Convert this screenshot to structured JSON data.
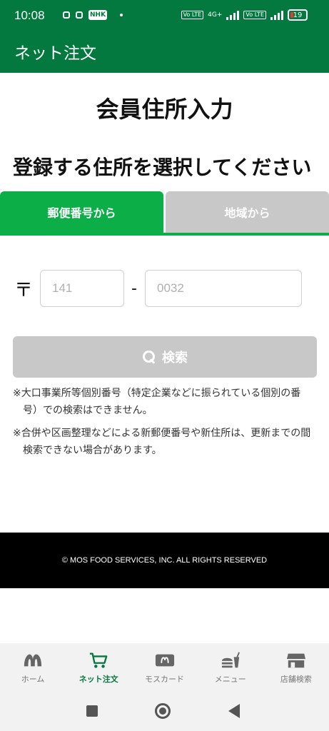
{
  "status_bar": {
    "time": "10:08",
    "nhk_label": "NHK",
    "network": "4G+",
    "volte_1": "Vo LTE",
    "volte_2": "Vo LTE",
    "battery": "19"
  },
  "app_bar": {
    "title": "ネット注文"
  },
  "page": {
    "title": "会員住所入力",
    "subtitle": "登録する住所を選択してください"
  },
  "tabs": [
    {
      "label": "郵便番号から",
      "active": true
    },
    {
      "label": "地域から",
      "active": false
    }
  ],
  "postal": {
    "symbol": "〒",
    "first_placeholder": "141",
    "separator": "-",
    "second_placeholder": "0032"
  },
  "search_button": {
    "label": "検索",
    "icon": "search-icon"
  },
  "notes": [
    "※大口事業所等個別番号（特定企業などに振られている個別の番号）での検索はできません。",
    "※合併や区画整理などによる新郵便番号や新住所は、更新までの間検索できない場合があります。"
  ],
  "footer": {
    "copyright": "© MOS FOOD SERVICES, INC. ALL RIGHTS RESERVED"
  },
  "bottom_nav": [
    {
      "label": "ホーム",
      "icon": "mos-logo-icon",
      "active": false
    },
    {
      "label": "ネット注文",
      "icon": "cart-icon",
      "active": true
    },
    {
      "label": "モスカード",
      "icon": "card-icon",
      "active": false
    },
    {
      "label": "メニュー",
      "icon": "burger-drink-icon",
      "active": false
    },
    {
      "label": "店舗検索",
      "icon": "store-icon",
      "active": false
    }
  ],
  "colors": {
    "brand_green": "#04793f",
    "tab_active": "#0cae48",
    "tab_inactive": "#c8c8c8",
    "button_disabled": "#c8c8c8"
  }
}
